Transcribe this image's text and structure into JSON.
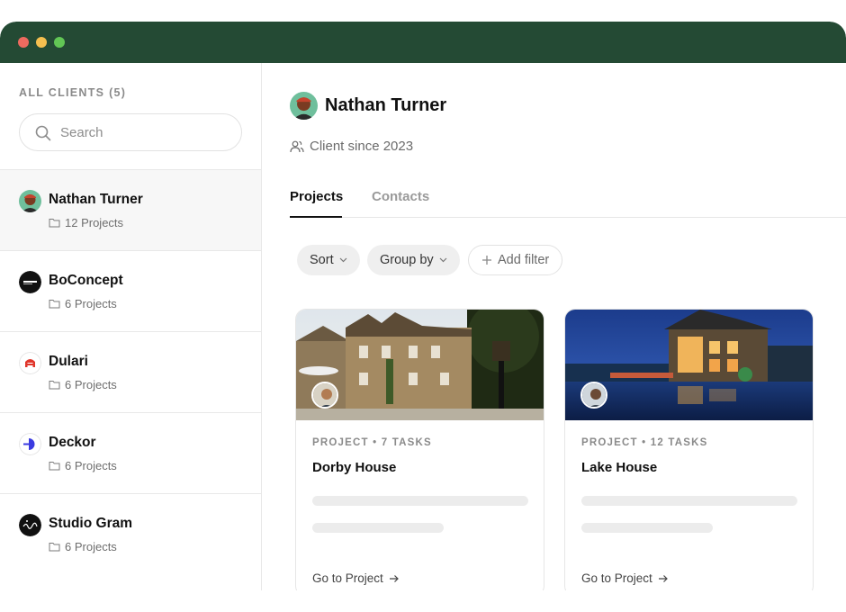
{
  "sidebar": {
    "heading": "ALL CLIENTS (5)",
    "search_placeholder": "Search",
    "clients": [
      {
        "name": "Nathan Turner",
        "projects": "12 Projects",
        "active": true
      },
      {
        "name": "BoConcept",
        "projects": "6 Projects",
        "active": false
      },
      {
        "name": "Dulari",
        "projects": "6 Projects",
        "active": false
      },
      {
        "name": "Deckor",
        "projects": "6 Projects",
        "active": false
      },
      {
        "name": "Studio Gram",
        "projects": "6 Projects",
        "active": false
      }
    ]
  },
  "main": {
    "client_name": "Nathan Turner",
    "client_since": "Client since 2023",
    "tabs": [
      {
        "label": "Projects",
        "active": true
      },
      {
        "label": "Contacts",
        "active": false
      }
    ],
    "filters": {
      "sort_label": "Sort",
      "group_label": "Group by",
      "add_filter_label": "Add filter"
    },
    "projects": [
      {
        "meta": "PROJECT • 7 TASKS",
        "title": "Dorby House",
        "link": "Go to Project"
      },
      {
        "meta": "PROJECT • 12 TASKS",
        "title": "Lake House",
        "link": "Go to Project"
      }
    ]
  },
  "colors": {
    "titlebar": "#244a34",
    "accent_text": "#111111",
    "muted_text": "#8a8a8a"
  }
}
